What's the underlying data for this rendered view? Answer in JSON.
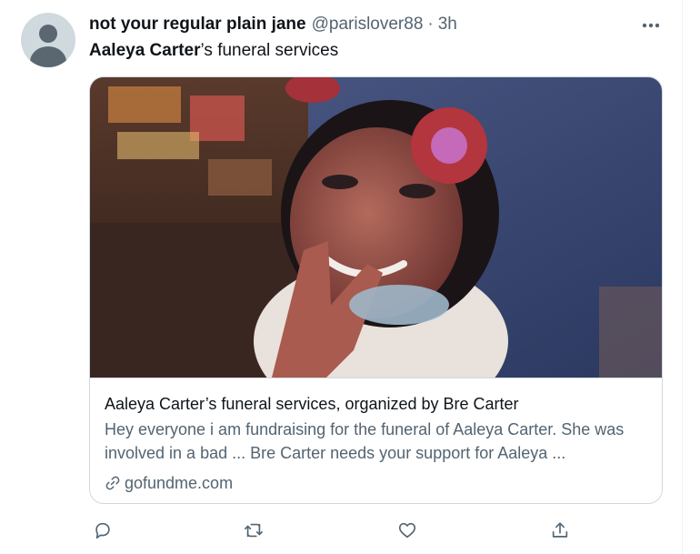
{
  "tweet": {
    "display_name": "not your regular plain jane",
    "handle": "@parislover88",
    "separator": "·",
    "time": "3h",
    "text_name": "Aaleya Carter",
    "text_rest": "’s funeral services"
  },
  "card": {
    "title": "Aaleya Carter’s funeral services, organized by Bre Carter",
    "description": "Hey everyone i am fundraising for the funeral of Aaleya Carter. She was involved in a bad ... Bre Carter needs your support for Aaleya ...",
    "domain": "gofundme.com"
  },
  "icons": {
    "more": "more-icon",
    "link": "link-icon",
    "reply": "reply-icon",
    "retweet": "retweet-icon",
    "like": "heart-icon",
    "share": "share-icon"
  },
  "colors": {
    "text_primary": "#0f1419",
    "text_secondary": "#536471",
    "border": "#cfd9de"
  }
}
